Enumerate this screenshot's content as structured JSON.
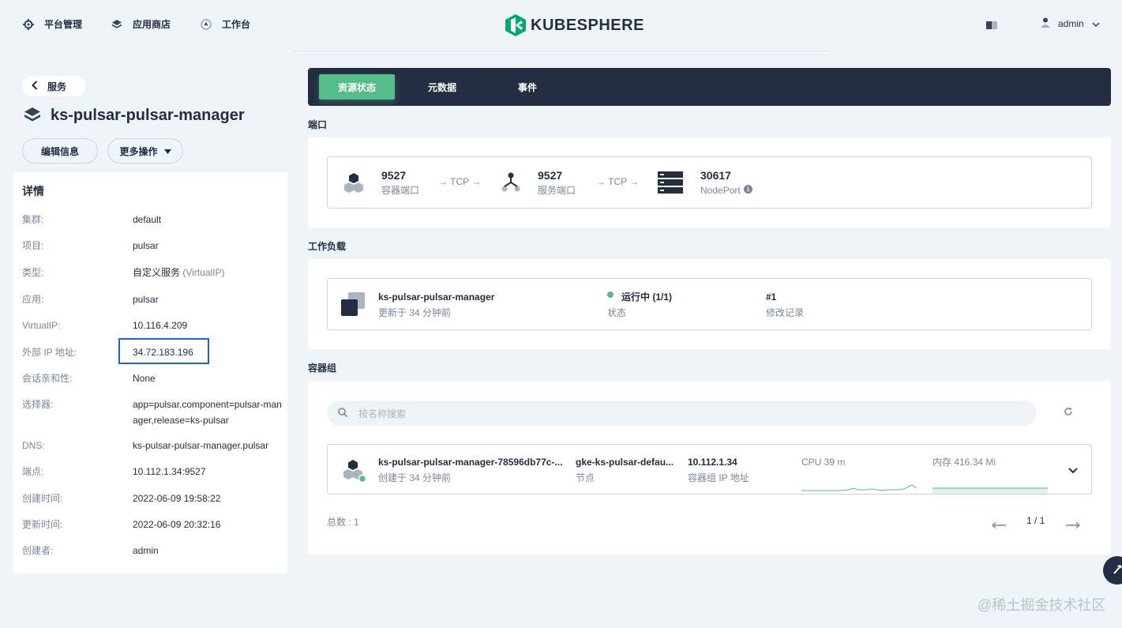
{
  "nav": {
    "items": [
      {
        "label": "平台管理",
        "icon": "gear-icon"
      },
      {
        "label": "应用商店",
        "icon": "layers-icon"
      },
      {
        "label": "工作台",
        "icon": "workbench-icon"
      }
    ],
    "logo": "KUBESPHERE",
    "user": "admin"
  },
  "left": {
    "back_label": "服务",
    "service_name": "ks-pulsar-pulsar-manager",
    "edit_label": "编辑信息",
    "more_label": "更多操作",
    "details_title": "详情",
    "details": [
      {
        "key": "集群:",
        "value": "default"
      },
      {
        "key": "项目:",
        "value": "pulsar"
      },
      {
        "key": "类型:",
        "value": "自定义服务",
        "sub": "(VirtualIP)"
      },
      {
        "key": "应用:",
        "value": "pulsar"
      },
      {
        "key": "VirtualIP:",
        "value": "10.116.4.209"
      },
      {
        "key": "外部 IP 地址:",
        "value": "34.72.183.196"
      },
      {
        "key": "会话亲和性:",
        "value": "None"
      },
      {
        "key": "选择器:",
        "value": "app=pulsar,component=pulsar-manager,release=ks-pulsar"
      },
      {
        "key": "DNS:",
        "value": "ks-pulsar-pulsar-manager.pulsar"
      },
      {
        "key": "端点:",
        "value": "10.112.1.34:9527"
      },
      {
        "key": "创建时间:",
        "value": "2022-06-09 19:58:22"
      },
      {
        "key": "更新时间:",
        "value": "2022-06-09 20:32:16"
      },
      {
        "key": "创建者:",
        "value": "admin"
      }
    ]
  },
  "tabs": [
    "资源状态",
    "元数据",
    "事件"
  ],
  "ports": {
    "title": "端口",
    "container_port": "9527",
    "container_port_label": "容器端口",
    "protocol1": "→ TCP →",
    "service_port": "9527",
    "service_port_label": "服务端口",
    "protocol2": "→ TCP →",
    "node_port": "30617",
    "node_port_label": "NodePort"
  },
  "workload": {
    "title": "工作负载",
    "name": "ks-pulsar-pulsar-manager",
    "updated": "更新于 34 分钟前",
    "status": "运行中 (1/1)",
    "status_label": "状态",
    "revision": "#1",
    "revision_label": "修改记录"
  },
  "pods": {
    "title": "容器组",
    "search_placeholder": "按名称搜索",
    "pod_name": "ks-pulsar-pulsar-manager-78596db77c-...",
    "created": "创建于 34 分钟前",
    "node": "gke-ks-pulsar-defau...",
    "node_label": "节点",
    "ip": "10.112.1.34",
    "ip_label": "容器组 IP 地址",
    "cpu": "CPU 39 m",
    "memory": "内存 416.34 Mi",
    "total": "总数 :  1",
    "page": "1 / 1"
  },
  "colors": {
    "accent": "#55bc8a",
    "dark": "#242e42",
    "highlight": "#1b64c8"
  },
  "watermark": "@稀土掘金技术社区"
}
